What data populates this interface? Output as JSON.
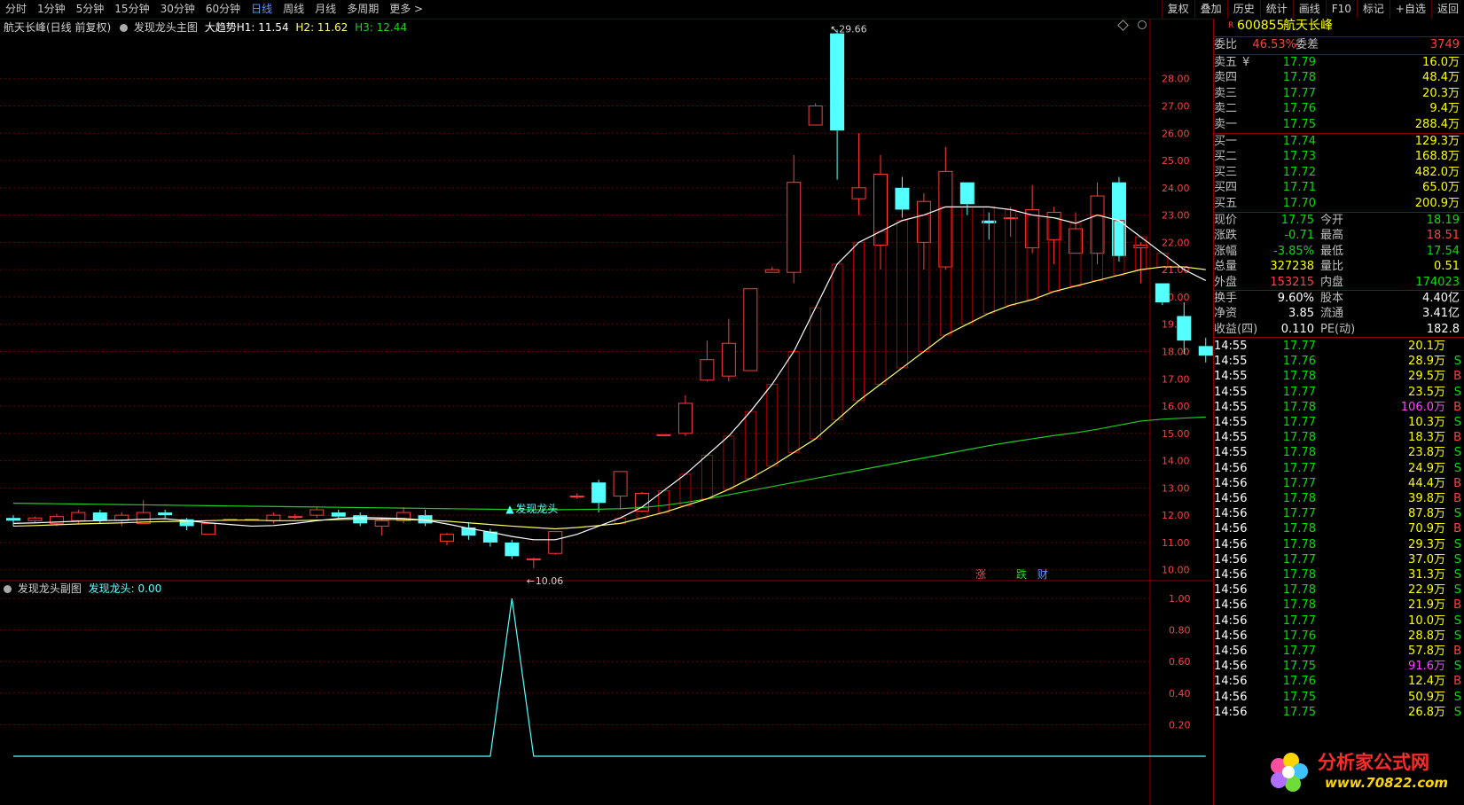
{
  "toolbar": {
    "period_tabs": [
      "分时",
      "1分钟",
      "5分钟",
      "15分钟",
      "30分钟",
      "60分钟",
      "日线",
      "周线",
      "月线",
      "多周期",
      "更多 >"
    ],
    "active_tab": 6,
    "tools": [
      "复权",
      "叠加",
      "历史",
      "统计",
      "画线",
      "F10",
      "标记",
      "+自选",
      "返回"
    ]
  },
  "main_chart": {
    "title": "航天长峰(日线 前复权)",
    "indicator": "发现龙头主图",
    "trend_label": "大趋势",
    "h1_label": "H1: 11.54",
    "h2_label": "H2: 11.62",
    "h3_label": "H3: 12.44",
    "high_marker": "29.66",
    "low_marker": "10.06",
    "signal_label": "发现龙头",
    "y_ticks": [
      "28.00",
      "27.00",
      "26.00",
      "25.00",
      "24.00",
      "23.00",
      "22.00",
      "21.00",
      "20.00",
      "19.00",
      "18.00",
      "17.00",
      "16.00",
      "15.00",
      "14.00",
      "13.00",
      "12.00",
      "11.00",
      "10.00"
    ],
    "badges": [
      "涨",
      "跌",
      "财"
    ]
  },
  "sub_chart": {
    "title": "发现龙头副图",
    "value_label": "发现龙头: 0.00",
    "y_ticks": [
      "1.00",
      "0.80",
      "0.60",
      "0.40",
      "0.20"
    ]
  },
  "chart_data": {
    "type": "candlestick",
    "ylim": [
      9.6,
      30.2
    ],
    "candles": [
      [
        11.9,
        11.8,
        12.0,
        11.6
      ],
      [
        11.8,
        11.9,
        11.95,
        11.7
      ],
      [
        11.7,
        11.95,
        12.05,
        11.6
      ],
      [
        11.8,
        12.1,
        12.2,
        11.7
      ],
      [
        12.1,
        11.8,
        12.2,
        11.7
      ],
      [
        11.8,
        12.0,
        12.1,
        11.6
      ],
      [
        11.7,
        12.1,
        12.55,
        11.7
      ],
      [
        12.1,
        12.0,
        12.2,
        11.9
      ],
      [
        11.85,
        11.6,
        11.9,
        11.45
      ],
      [
        11.3,
        11.7,
        11.7,
        11.3
      ],
      [
        11.85,
        11.85,
        11.85,
        11.85
      ],
      [
        11.85,
        11.85,
        11.85,
        11.85
      ],
      [
        11.8,
        12.0,
        12.1,
        11.7
      ],
      [
        11.95,
        11.95,
        12.05,
        11.85
      ],
      [
        12.0,
        12.2,
        12.3,
        11.9
      ],
      [
        12.1,
        11.95,
        12.2,
        11.9
      ],
      [
        12.0,
        11.7,
        12.1,
        11.6
      ],
      [
        11.6,
        11.8,
        11.9,
        11.25
      ],
      [
        11.8,
        12.1,
        12.3,
        11.7
      ],
      [
        12.0,
        11.7,
        12.2,
        11.6
      ],
      [
        11.05,
        11.3,
        11.35,
        10.9
      ],
      [
        11.55,
        11.25,
        11.75,
        11.1
      ],
      [
        11.4,
        11.0,
        11.5,
        10.85
      ],
      [
        11.0,
        10.5,
        11.1,
        10.4
      ],
      [
        10.4,
        10.4,
        10.45,
        10.06
      ],
      [
        10.6,
        11.4,
        11.4,
        10.55
      ],
      [
        12.7,
        12.7,
        12.8,
        12.6
      ],
      [
        13.2,
        12.45,
        13.3,
        12.1
      ],
      [
        12.7,
        13.6,
        13.6,
        12.2
      ],
      [
        12.15,
        12.8,
        12.85,
        12.1
      ],
      [
        14.95,
        14.95,
        14.95,
        14.95
      ],
      [
        15.0,
        16.1,
        16.4,
        14.9
      ],
      [
        16.95,
        17.7,
        18.4,
        16.9
      ],
      [
        17.1,
        18.3,
        19.2,
        16.9
      ],
      [
        17.3,
        20.3,
        20.3,
        17.3
      ],
      [
        20.9,
        21.0,
        21.1,
        20.9
      ],
      [
        20.9,
        24.2,
        25.2,
        20.5
      ],
      [
        26.3,
        27.0,
        27.1,
        26.3
      ],
      [
        29.66,
        26.1,
        29.8,
        24.3
      ],
      [
        23.6,
        24.0,
        26.0,
        23.0
      ],
      [
        21.9,
        24.5,
        25.2,
        21.0
      ],
      [
        24.0,
        23.2,
        24.4,
        22.9
      ],
      [
        22.0,
        23.5,
        23.8,
        21.0
      ],
      [
        21.1,
        24.6,
        25.5,
        21.0
      ],
      [
        24.2,
        23.4,
        24.2,
        23.0
      ],
      [
        22.8,
        22.7,
        23.1,
        22.1
      ],
      [
        22.9,
        22.9,
        23.3,
        22.2
      ],
      [
        21.8,
        23.2,
        24.1,
        21.6
      ],
      [
        22.1,
        23.1,
        23.3,
        21.2
      ],
      [
        21.6,
        22.5,
        23.1,
        21.6
      ],
      [
        21.6,
        23.7,
        24.2,
        21.2
      ],
      [
        24.2,
        21.5,
        24.4,
        21.3
      ],
      [
        21.8,
        21.9,
        22.0,
        20.5
      ],
      [
        20.5,
        19.8,
        20.4,
        19.7
      ],
      [
        19.3,
        18.4,
        19.8,
        17.9
      ],
      [
        18.2,
        17.85,
        18.5,
        17.6
      ]
    ],
    "ma_white": [
      11.7,
      11.72,
      11.75,
      11.78,
      11.8,
      11.82,
      11.85,
      11.87,
      11.8,
      11.72,
      11.66,
      11.6,
      11.62,
      11.7,
      11.8,
      11.88,
      11.92,
      11.9,
      11.88,
      11.82,
      11.68,
      11.52,
      11.38,
      11.22,
      11.1,
      11.1,
      11.3,
      11.6,
      11.9,
      12.3,
      12.9,
      13.5,
      14.2,
      14.9,
      15.8,
      16.8,
      18.0,
      19.6,
      21.2,
      22.0,
      22.4,
      22.8,
      23.0,
      23.3,
      23.3,
      23.3,
      23.2,
      23.0,
      22.9,
      22.7,
      23.0,
      22.8,
      22.2,
      21.6,
      21.0,
      20.6
    ],
    "ma_yellow": [
      11.6,
      11.62,
      11.65,
      11.68,
      11.7,
      11.72,
      11.75,
      11.77,
      11.78,
      11.8,
      11.82,
      11.82,
      11.8,
      11.8,
      11.82,
      11.84,
      11.86,
      11.85,
      11.84,
      11.82,
      11.78,
      11.72,
      11.66,
      11.6,
      11.55,
      11.5,
      11.55,
      11.62,
      11.7,
      11.9,
      12.1,
      12.35,
      12.6,
      12.95,
      13.35,
      13.8,
      14.3,
      14.8,
      15.5,
      16.2,
      16.8,
      17.4,
      18.0,
      18.6,
      19.0,
      19.4,
      19.7,
      19.9,
      20.2,
      20.4,
      20.6,
      20.8,
      21.0,
      21.1,
      21.1,
      21.0
    ],
    "ma_green": [
      12.44,
      12.43,
      12.42,
      12.41,
      12.4,
      12.39,
      12.38,
      12.37,
      12.36,
      12.35,
      12.34,
      12.33,
      12.32,
      12.31,
      12.3,
      12.29,
      12.28,
      12.27,
      12.26,
      12.25,
      12.24,
      12.23,
      12.22,
      12.21,
      12.2,
      12.2,
      12.21,
      12.22,
      12.24,
      12.28,
      12.36,
      12.47,
      12.6,
      12.75,
      12.9,
      13.05,
      13.2,
      13.35,
      13.5,
      13.65,
      13.8,
      13.95,
      14.1,
      14.25,
      14.4,
      14.55,
      14.68,
      14.8,
      14.92,
      15.02,
      15.15,
      15.3,
      15.45,
      15.52,
      15.56,
      15.6
    ],
    "signal_index": 23,
    "sub_values": [
      0,
      0,
      0,
      0,
      0,
      0,
      0,
      0,
      0,
      0,
      0,
      0,
      0,
      0,
      0,
      0,
      0,
      0,
      0,
      0,
      0,
      0,
      0,
      1,
      0,
      0,
      0,
      0,
      0,
      0,
      0,
      0,
      0,
      0,
      0,
      0,
      0,
      0,
      0,
      0,
      0,
      0,
      0,
      0,
      0,
      0,
      0,
      0,
      0,
      0,
      0,
      0,
      0,
      0,
      0,
      0
    ]
  },
  "quote": {
    "badge": "R",
    "code": "600855",
    "name": "航天长峰",
    "weibi_label": "委比",
    "weibi": "46.53%",
    "weicha_label": "委差",
    "weicha": "3749",
    "sell": [
      {
        "label": "卖五",
        "mark": "¥",
        "price": "17.79",
        "vol": "16.0万"
      },
      {
        "label": "卖四",
        "mark": "",
        "price": "17.78",
        "vol": "48.4万"
      },
      {
        "label": "卖三",
        "mark": "",
        "price": "17.77",
        "vol": "20.3万"
      },
      {
        "label": "卖二",
        "mark": "",
        "price": "17.76",
        "vol": "9.4万"
      },
      {
        "label": "卖一",
        "mark": "",
        "price": "17.75",
        "vol": "288.4万"
      }
    ],
    "buy": [
      {
        "label": "买一",
        "price": "17.74",
        "vol": "129.3万"
      },
      {
        "label": "买二",
        "price": "17.73",
        "vol": "168.8万"
      },
      {
        "label": "买三",
        "price": "17.72",
        "vol": "482.0万"
      },
      {
        "label": "买四",
        "price": "17.71",
        "vol": "65.0万"
      },
      {
        "label": "买五",
        "price": "17.70",
        "vol": "200.9万"
      }
    ],
    "stats": [
      [
        {
          "l": "现价",
          "v": "17.75",
          "c": "#00e000"
        },
        {
          "l": "今开",
          "v": "18.19",
          "c": "#00e000"
        }
      ],
      [
        {
          "l": "涨跌",
          "v": "-0.71",
          "c": "#00e000"
        },
        {
          "l": "最高",
          "v": "18.51",
          "c": "#ff4040"
        }
      ],
      [
        {
          "l": "涨幅",
          "v": "-3.85%",
          "c": "#00e000"
        },
        {
          "l": "最低",
          "v": "17.54",
          "c": "#00e000"
        }
      ],
      [
        {
          "l": "总量",
          "v": "327238",
          "c": "#ffff00"
        },
        {
          "l": "量比",
          "v": "0.51",
          "c": "#ffff00"
        }
      ],
      [
        {
          "l": "外盘",
          "v": "153215",
          "c": "#ff4040"
        },
        {
          "l": "内盘",
          "v": "174023",
          "c": "#00e000"
        }
      ]
    ],
    "fund": [
      [
        {
          "l": "换手",
          "v": "9.60%"
        },
        {
          "l": "股本",
          "v": "4.40亿"
        }
      ],
      [
        {
          "l": "净资",
          "v": "3.85"
        },
        {
          "l": "流通",
          "v": "3.41亿"
        }
      ],
      [
        {
          "l": "收益(四)",
          "v": "0.110"
        },
        {
          "l": "PE(动)",
          "v": "182.8"
        }
      ]
    ],
    "ticks": [
      {
        "t": "14:55",
        "p": "17.77",
        "v": "20.1万",
        "s": ""
      },
      {
        "t": "14:55",
        "p": "17.76",
        "v": "28.9万",
        "s": "S"
      },
      {
        "t": "14:55",
        "p": "17.78",
        "v": "29.5万",
        "s": "B"
      },
      {
        "t": "14:55",
        "p": "17.77",
        "v": "23.5万",
        "s": "S"
      },
      {
        "t": "14:55",
        "p": "17.78",
        "v": "106.0万",
        "s": "B"
      },
      {
        "t": "14:55",
        "p": "17.77",
        "v": "10.3万",
        "s": "S"
      },
      {
        "t": "14:55",
        "p": "17.78",
        "v": "18.3万",
        "s": "B"
      },
      {
        "t": "14:55",
        "p": "17.78",
        "v": "23.8万",
        "s": "S"
      },
      {
        "t": "14:56",
        "p": "17.77",
        "v": "24.9万",
        "s": "S"
      },
      {
        "t": "14:56",
        "p": "17.77",
        "v": "44.4万",
        "s": "B"
      },
      {
        "t": "14:56",
        "p": "17.78",
        "v": "39.8万",
        "s": "B"
      },
      {
        "t": "14:56",
        "p": "17.77",
        "v": "87.8万",
        "s": "S"
      },
      {
        "t": "14:56",
        "p": "17.78",
        "v": "70.9万",
        "s": "B"
      },
      {
        "t": "14:56",
        "p": "17.78",
        "v": "29.3万",
        "s": "S"
      },
      {
        "t": "14:56",
        "p": "17.77",
        "v": "37.0万",
        "s": "S"
      },
      {
        "t": "14:56",
        "p": "17.78",
        "v": "31.3万",
        "s": "S"
      },
      {
        "t": "14:56",
        "p": "17.78",
        "v": "22.9万",
        "s": "S"
      },
      {
        "t": "14:56",
        "p": "17.78",
        "v": "21.9万",
        "s": "B"
      },
      {
        "t": "14:56",
        "p": "17.77",
        "v": "10.0万",
        "s": "S"
      },
      {
        "t": "14:56",
        "p": "17.76",
        "v": "28.8万",
        "s": "S"
      },
      {
        "t": "14:56",
        "p": "17.77",
        "v": "57.8万",
        "s": "B"
      },
      {
        "t": "14:56",
        "p": "17.75",
        "v": "91.6万",
        "s": "S"
      },
      {
        "t": "14:56",
        "p": "17.76",
        "v": "12.4万",
        "s": "B"
      },
      {
        "t": "14:56",
        "p": "17.75",
        "v": "50.9万",
        "s": "S"
      },
      {
        "t": "14:56",
        "p": "17.75",
        "v": "26.8万",
        "s": "S"
      }
    ]
  },
  "watermark": {
    "text": "分析家公式网",
    "url": "www.70822.com"
  },
  "colors": {
    "up": "#ff3b3b",
    "down": "#54ffff",
    "grid": "#6a0000",
    "ma_white": "#ffffff",
    "ma_yellow": "#ffff66",
    "ma_green": "#22cc22"
  }
}
